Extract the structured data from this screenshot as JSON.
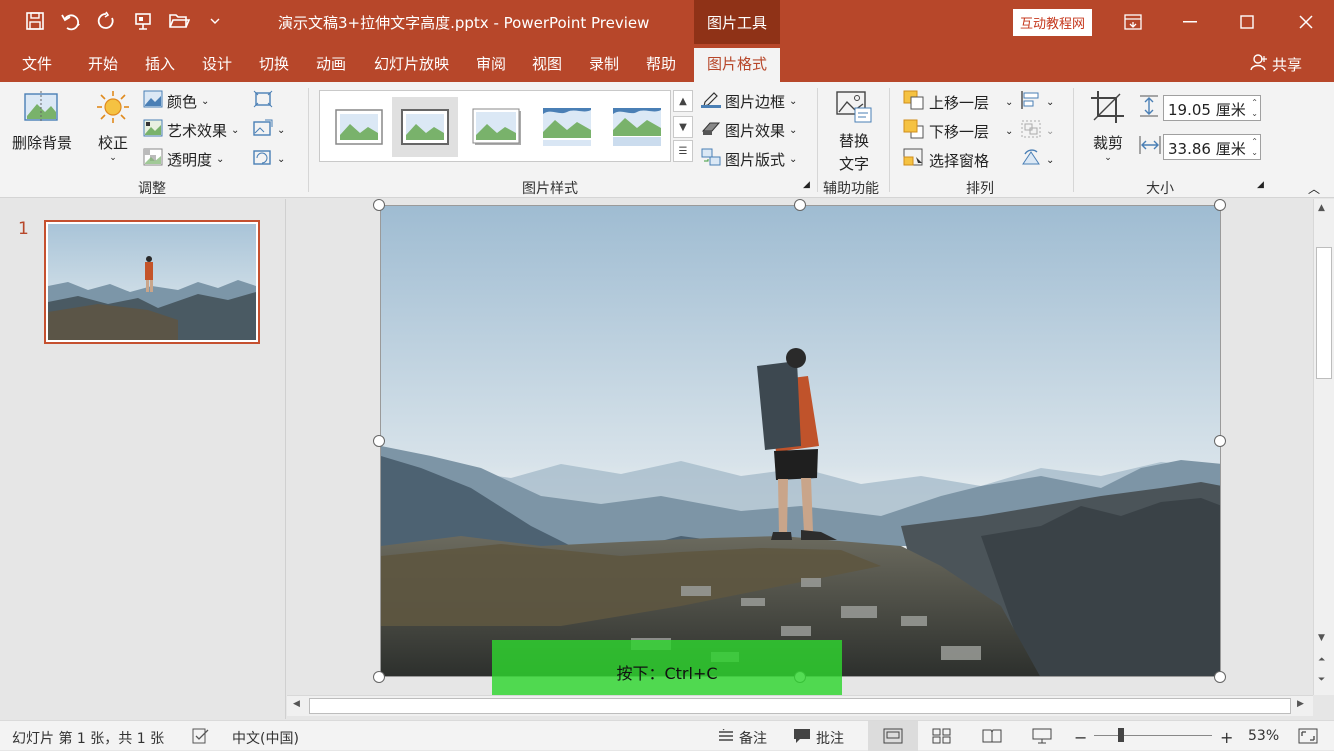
{
  "titlebar": {
    "document_title": "演示文稿3+拉伸文字高度.pptx  -  PowerPoint Preview",
    "context_tab": "图片工具",
    "badge": "互动教程网",
    "bg_color": "#b7472a"
  },
  "tabs": {
    "items": [
      "文件",
      "开始",
      "插入",
      "设计",
      "切换",
      "动画",
      "幻灯片放映",
      "审阅",
      "视图",
      "录制",
      "帮助",
      "图片格式"
    ],
    "active": "图片格式",
    "share": "共享"
  },
  "ribbon": {
    "remove_bg": "删除背景",
    "corrections": "校正",
    "color": "颜色",
    "artistic": "艺术效果",
    "transparency": "透明度",
    "group_adjust": "调整",
    "group_styles": "图片样式",
    "border": "图片边框",
    "effects": "图片效果",
    "layout": "图片版式",
    "alt_text_line1": "替换",
    "alt_text_line2": "文字",
    "group_accessibility": "辅助功能",
    "bring_forward": "上移一层",
    "send_backward": "下移一层",
    "selection_pane": "选择窗格",
    "group_arrange": "排列",
    "crop": "裁剪",
    "height": "19.05 厘米",
    "width": "33.86 厘米",
    "group_size": "大小"
  },
  "slides": {
    "number": "1"
  },
  "overlay": {
    "hint": "按下：Ctrl+C"
  },
  "status": {
    "slide_info": "幻灯片 第 1 张，共 1 张",
    "language": "中文(中国)",
    "notes": "备注",
    "comments": "批注",
    "zoom": "53%"
  },
  "icons": [
    "save-icon",
    "undo-icon",
    "redo-icon",
    "present-icon",
    "open-icon",
    "customize-icon",
    "ribbon-display-icon",
    "minimize-icon",
    "maximize-icon",
    "close-icon",
    "person-icon"
  ]
}
